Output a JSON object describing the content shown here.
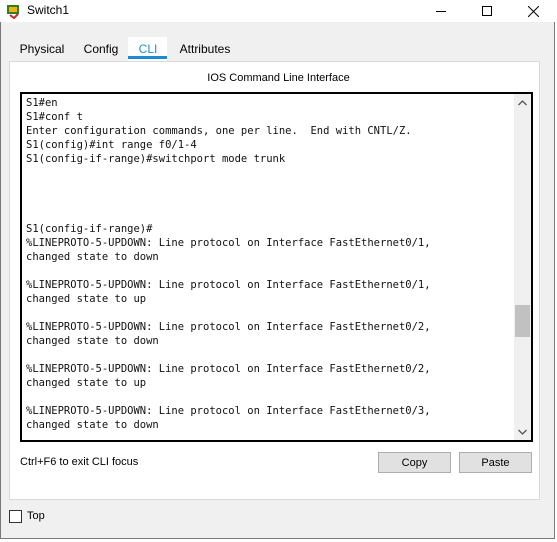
{
  "window": {
    "title": "Switch1"
  },
  "tabs": [
    {
      "label": "Physical"
    },
    {
      "label": "Config"
    },
    {
      "label": "CLI"
    },
    {
      "label": "Attributes"
    }
  ],
  "active_tab": "CLI",
  "cli": {
    "pane_title": "IOS Command Line Interface",
    "lines": [
      "S1#en",
      "S1#conf t",
      "Enter configuration commands, one per line.  End with CNTL/Z.",
      "S1(config)#int range f0/1-4",
      "S1(config-if-range)#switchport mode trunk",
      "",
      "",
      "",
      "",
      "S1(config-if-range)#",
      "%LINEPROTO-5-UPDOWN: Line protocol on Interface FastEthernet0/1,",
      "changed state to down",
      "",
      "%LINEPROTO-5-UPDOWN: Line protocol on Interface FastEthernet0/1,",
      "changed state to up",
      "",
      "%LINEPROTO-5-UPDOWN: Line protocol on Interface FastEthernet0/2,",
      "changed state to down",
      "",
      "%LINEPROTO-5-UPDOWN: Line protocol on Interface FastEthernet0/2,",
      "changed state to up",
      "",
      "%LINEPROTO-5-UPDOWN: Line protocol on Interface FastEthernet0/3,",
      "changed state to down"
    ],
    "hint": "Ctrl+F6 to exit CLI focus",
    "copy_label": "Copy",
    "paste_label": "Paste"
  },
  "footer": {
    "top_label": "Top",
    "top_checked": false
  },
  "colors": {
    "accent": "#1e8ad6"
  }
}
